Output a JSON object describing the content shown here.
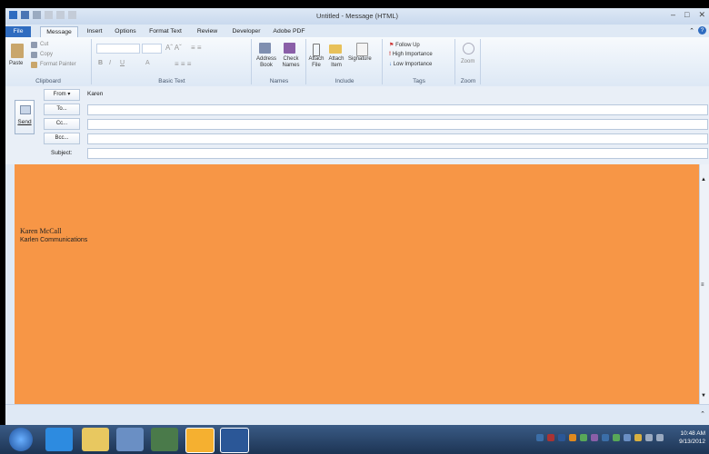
{
  "window": {
    "title": "Untitled - Message (HTML)"
  },
  "ribbon_tabs": [
    "File",
    "Message",
    "Insert",
    "Options",
    "Format Text",
    "Review",
    "Developer",
    "Adobe PDF"
  ],
  "ribbon": {
    "clipboard": {
      "paste": "Paste",
      "cut": "Cut",
      "copy": "Copy",
      "format_painter": "Format Painter",
      "label": "Clipboard"
    },
    "basic_text": {
      "label": "Basic Text"
    },
    "names": {
      "address_book": "Address Book",
      "check_names": "Check Names",
      "label": "Names"
    },
    "include": {
      "attach_file": "Attach File",
      "attach_item": "Attach Item",
      "signature": "Signature",
      "label": "Include"
    },
    "tags": {
      "follow_up": "Follow Up",
      "high": "High Importance",
      "low": "Low Importance",
      "label": "Tags"
    },
    "zoom": {
      "zoom": "Zoom",
      "label": "Zoom"
    }
  },
  "header": {
    "send": "Send",
    "from_btn": "From",
    "from_value": "Karen",
    "to_btn": "To...",
    "cc_btn": "Cc...",
    "bcc_btn": "Bcc...",
    "subject_label": "Subject:"
  },
  "body": {
    "signature_name": "Karen McCall",
    "signature_company": "Karlen Communications"
  },
  "taskbar": {
    "time": "10:48 AM",
    "date": "9/13/2012"
  },
  "colors": {
    "body_bg": "#f79646",
    "file_tab": "#2f6cc0",
    "taskbar": "#1d3454"
  }
}
